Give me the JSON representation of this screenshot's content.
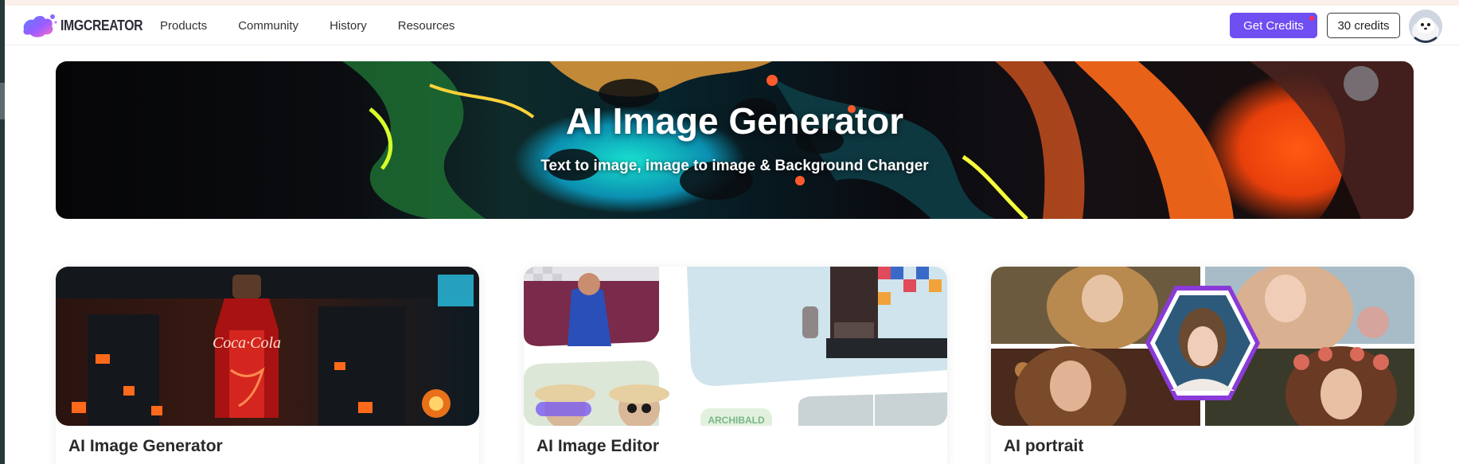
{
  "header": {
    "logo_text": "IMGCREATOR",
    "nav": [
      {
        "label": "Products"
      },
      {
        "label": "Community"
      },
      {
        "label": "History"
      },
      {
        "label": "Resources"
      }
    ],
    "get_credits_label": "Get Credits",
    "credits_label": "30 credits",
    "accent_color": "#6f4ef2"
  },
  "hero": {
    "title": "AI Image Generator",
    "subtitle": "Text to image, image to image & Background Changer"
  },
  "cards": [
    {
      "title": "AI Image Generator"
    },
    {
      "title": "AI Image Editor",
      "image_text": "ARCHIBALD"
    },
    {
      "title": "AI portrait"
    }
  ]
}
